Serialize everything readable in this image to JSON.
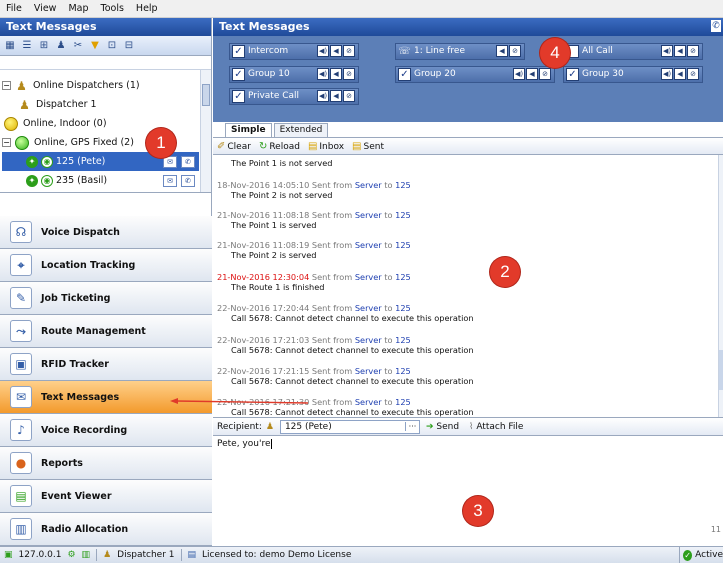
{
  "menu": [
    "File",
    "View",
    "Map",
    "Tools",
    "Help"
  ],
  "left_panel": {
    "title": "Text Messages",
    "tree": [
      {
        "label": "Online Dispatchers (1)",
        "type": "group-dispatcher"
      },
      {
        "label": "Dispatcher 1",
        "type": "dispatcher"
      },
      {
        "label": "Online, Indoor (0)",
        "type": "group-yellow"
      },
      {
        "label": "Online, GPS Fixed (2)",
        "type": "group-green"
      },
      {
        "label": "125 (Pete)",
        "type": "radio",
        "selected": true
      },
      {
        "label": "235 (Basil)",
        "type": "radio"
      }
    ],
    "nav": [
      {
        "label": "Voice Dispatch",
        "icon": "headset-icon"
      },
      {
        "label": "Location Tracking",
        "icon": "map-pin-icon"
      },
      {
        "label": "Job Ticketing",
        "icon": "ticket-icon"
      },
      {
        "label": "Route Management",
        "icon": "route-icon"
      },
      {
        "label": "RFID Tracker",
        "icon": "rfid-icon"
      },
      {
        "label": "Text Messages",
        "icon": "envelope-icon",
        "active": true
      },
      {
        "label": "Voice Recording",
        "icon": "microphone-icon"
      },
      {
        "label": "Reports",
        "icon": "report-icon"
      },
      {
        "label": "Event Viewer",
        "icon": "event-icon"
      },
      {
        "label": "Radio Allocation",
        "icon": "radio-icon"
      }
    ]
  },
  "right_panel": {
    "title": "Text Messages",
    "channels": [
      {
        "label": "Intercom",
        "checked": true
      },
      {
        "label": "1: Line free",
        "checked": false,
        "kind": "line"
      },
      {
        "label": "All Call",
        "checked": false
      },
      {
        "label": "Group 10",
        "checked": true
      },
      {
        "label": "Group 20",
        "checked": true
      },
      {
        "label": "Group 30",
        "checked": true
      },
      {
        "label": "Private Call",
        "checked": true
      }
    ],
    "tabs": [
      "Simple",
      "Extended"
    ],
    "toolbar": {
      "clear": "Clear",
      "reload": "Reload",
      "inbox": "Inbox",
      "sent": "Sent"
    },
    "messages": [
      {
        "time": "",
        "from": "",
        "to": "",
        "body": "The Point 1 is not served",
        "hot": false
      },
      {
        "time": "18-Nov-2016 14:05:10",
        "from": "Server",
        "to": "125",
        "body": "The Point 2 is not served",
        "hot": false
      },
      {
        "time": "21-Nov-2016 11:08:18",
        "from": "Server",
        "to": "125",
        "body": "The Point 1 is served",
        "hot": false
      },
      {
        "time": "21-Nov-2016 11:08:19",
        "from": "Server",
        "to": "125",
        "body": "The Point 2 is served",
        "hot": false
      },
      {
        "time": "21-Nov-2016 12:30:04",
        "from": "Server",
        "to": "125",
        "body": "The Route 1 is finished",
        "hot": true
      },
      {
        "time": "22-Nov-2016 17:20:44",
        "from": "Server",
        "to": "125",
        "body": "Call 5678: Cannot detect channel to execute this operation",
        "hot": false
      },
      {
        "time": "22-Nov-2016 17:21:03",
        "from": "Server",
        "to": "125",
        "body": "Call 5678: Cannot detect channel to execute this operation",
        "hot": false
      },
      {
        "time": "22-Nov-2016 17:21:15",
        "from": "Server",
        "to": "125",
        "body": "Call 5678: Cannot detect channel to execute this operation",
        "hot": false
      },
      {
        "time": "22-Nov-2016 17:21:30",
        "from": "Server",
        "to": "125",
        "body": "Call 5678: Cannot detect channel to execute this operation",
        "hot": false
      }
    ],
    "sent_from_text": "Sent from",
    "to_text": "to",
    "recipient_label": "Recipient:",
    "recipient_value": "125 (Pete)",
    "send_label": "Send",
    "attach_label": "Attach File",
    "compose_text": "Pete, you're",
    "char_count": "11"
  },
  "status": {
    "ip": "127.0.0.1",
    "user": "Dispatcher 1",
    "license": "Licensed to: demo Demo License",
    "state": "Active"
  },
  "callouts": [
    "1",
    "2",
    "3",
    "4"
  ]
}
